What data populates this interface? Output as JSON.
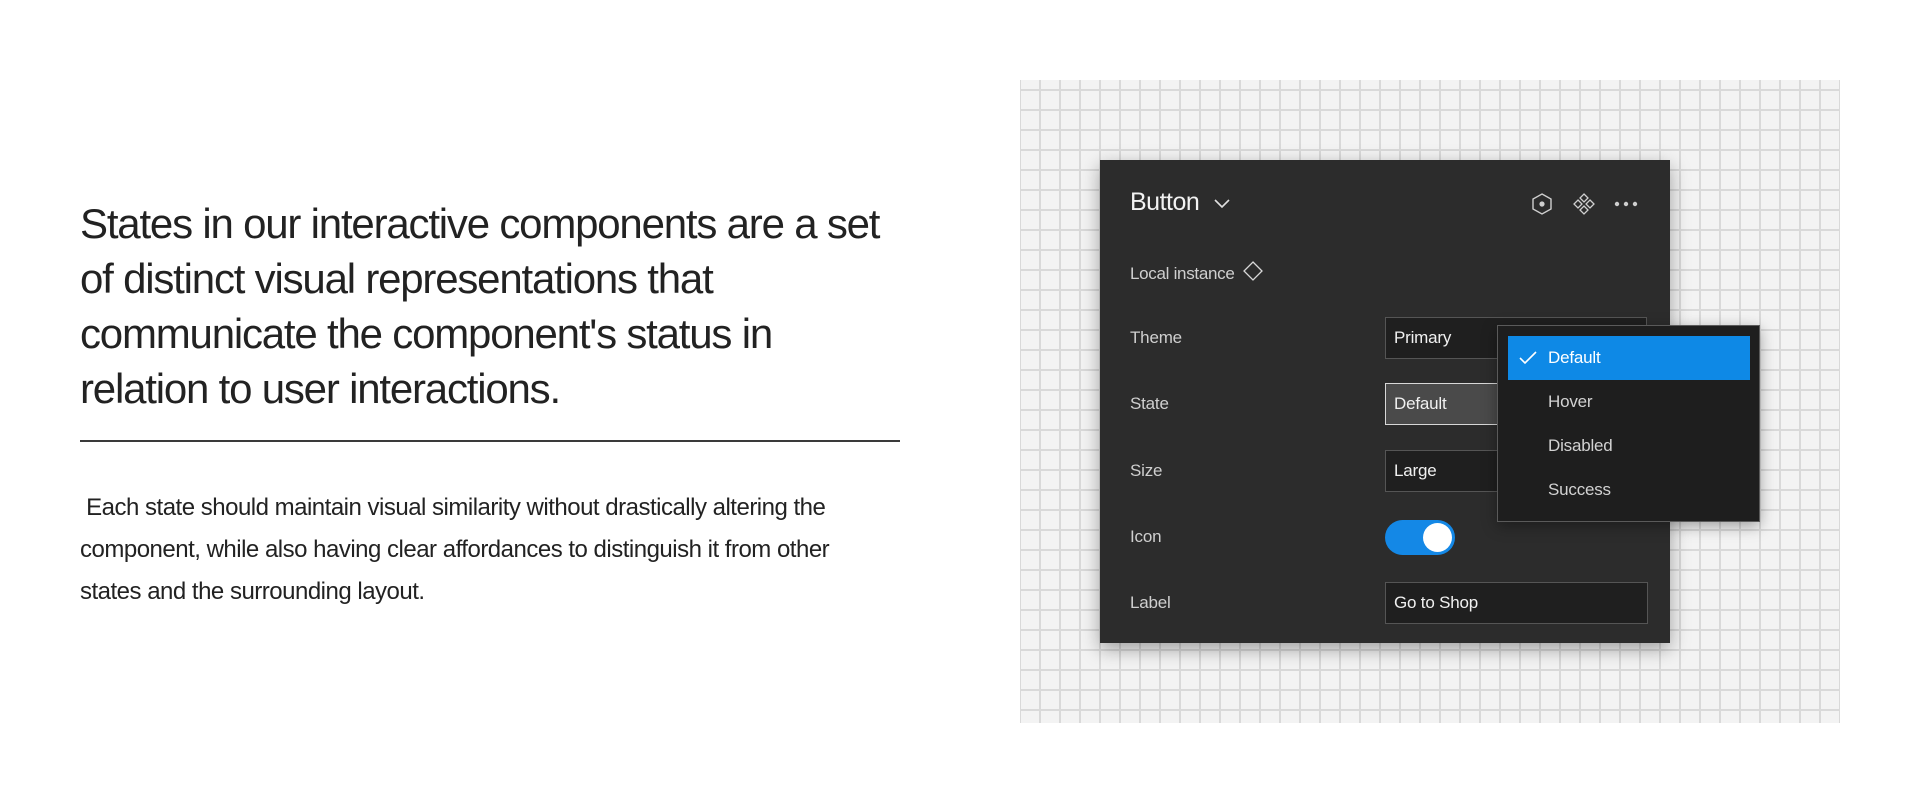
{
  "intro": {
    "headline": "States in our interactive components are a set of distinct visual representations that communicate the component's status in relation to user interactions.",
    "body": " Each state should maintain visual similarity without drastically altering the component, while also having clear affordances to distinguish it from other states and the surrounding layout."
  },
  "panel": {
    "title": "Button",
    "title_icon": "chevron-down-icon",
    "header_icons": [
      "component-instance-icon",
      "components-icon",
      "more-options-icon"
    ],
    "subtitle": "Local instance",
    "subtitle_icon": "diamond-icon",
    "properties": {
      "theme": {
        "label": "Theme",
        "value": "Primary"
      },
      "state": {
        "label": "State",
        "value": "Default"
      },
      "size": {
        "label": "Size",
        "value": "Large"
      },
      "icon": {
        "label": "Icon",
        "on": true
      },
      "label": {
        "label": "Label",
        "value": "Go to Shop"
      }
    }
  },
  "dropdown": {
    "selected": "Default",
    "options": [
      "Default",
      "Hover",
      "Disabled",
      "Success"
    ]
  },
  "colors": {
    "accent": "#0e89e6",
    "panel_bg": "#2c2c2c",
    "canvas_bg": "#f3f3f3"
  }
}
